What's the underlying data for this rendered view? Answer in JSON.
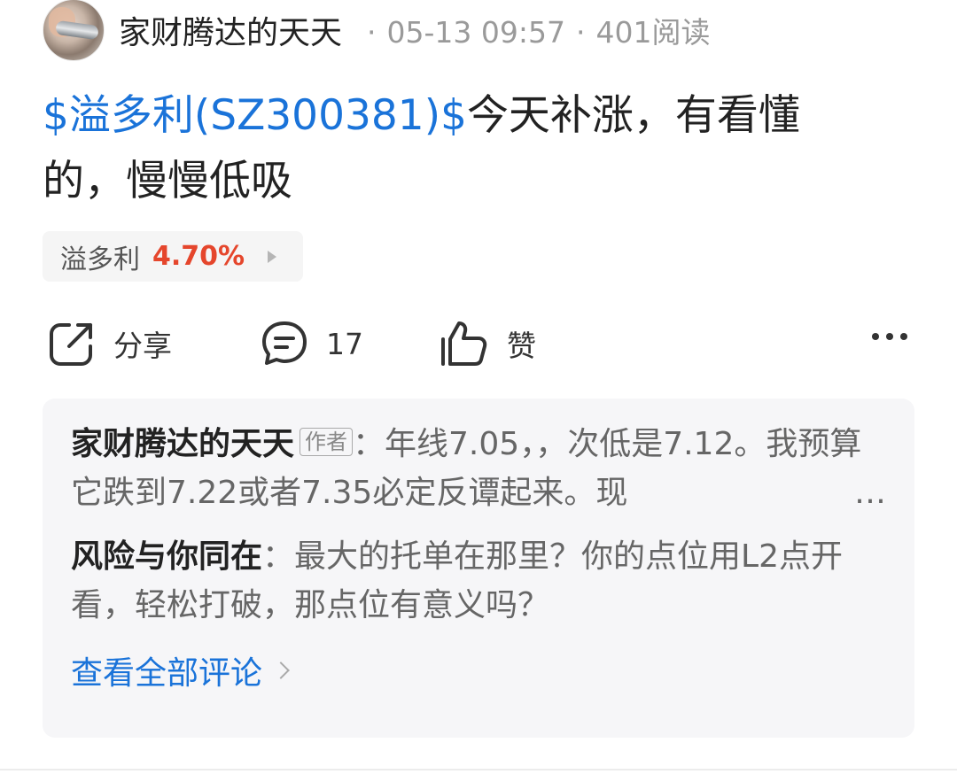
{
  "post": {
    "author": "家财腾达的天天",
    "date": "05-13 09:57",
    "views": "401阅读",
    "sep": "·",
    "title_tag": "$溢多利(SZ300381)$",
    "title_text": "今天补涨，有看懂的，慢慢低吸"
  },
  "stock_chip": {
    "name": "溢多利",
    "change": "4.70%",
    "change_color": "#e5462c"
  },
  "actions": {
    "share": "分享",
    "comments_count": "17",
    "like": "赞",
    "icons": [
      "share-icon",
      "comment-icon",
      "thumbs-up-icon",
      "more-icon"
    ]
  },
  "comments": [
    {
      "author": "家财腾达的天天",
      "badge": "作者",
      "sep": "：",
      "text": "年线7.05，，次低是7.12。我预算它跌到7.22或者7.35必定反谭起来。现",
      "ellipsis": "…"
    },
    {
      "author": "风险与你同在",
      "sep": "：",
      "text": "最大的托单在那里？你的点位用L2点开看，轻松打破，那点位有意义吗？"
    }
  ],
  "view_all": "查看全部评论",
  "colors": {
    "link": "#1a73d9",
    "up": "#e5462c"
  }
}
